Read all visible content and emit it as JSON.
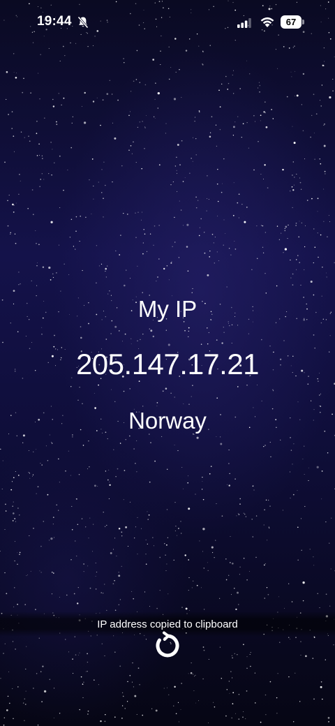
{
  "status_bar": {
    "time": "19:44",
    "battery_level": "67",
    "icons": [
      "bell-slash-icon",
      "cellular-signal-icon",
      "wifi-icon",
      "battery-icon"
    ]
  },
  "main": {
    "title": "My IP",
    "ip_address": "205.147.17.21",
    "country": "Norway"
  },
  "toast": {
    "message": "IP address copied to clipboard"
  },
  "controls": {
    "refresh_icon": "refresh-icon"
  },
  "colors": {
    "text": "#ffffff",
    "background": "#0b0b25",
    "sky_accent": "#14124a"
  }
}
